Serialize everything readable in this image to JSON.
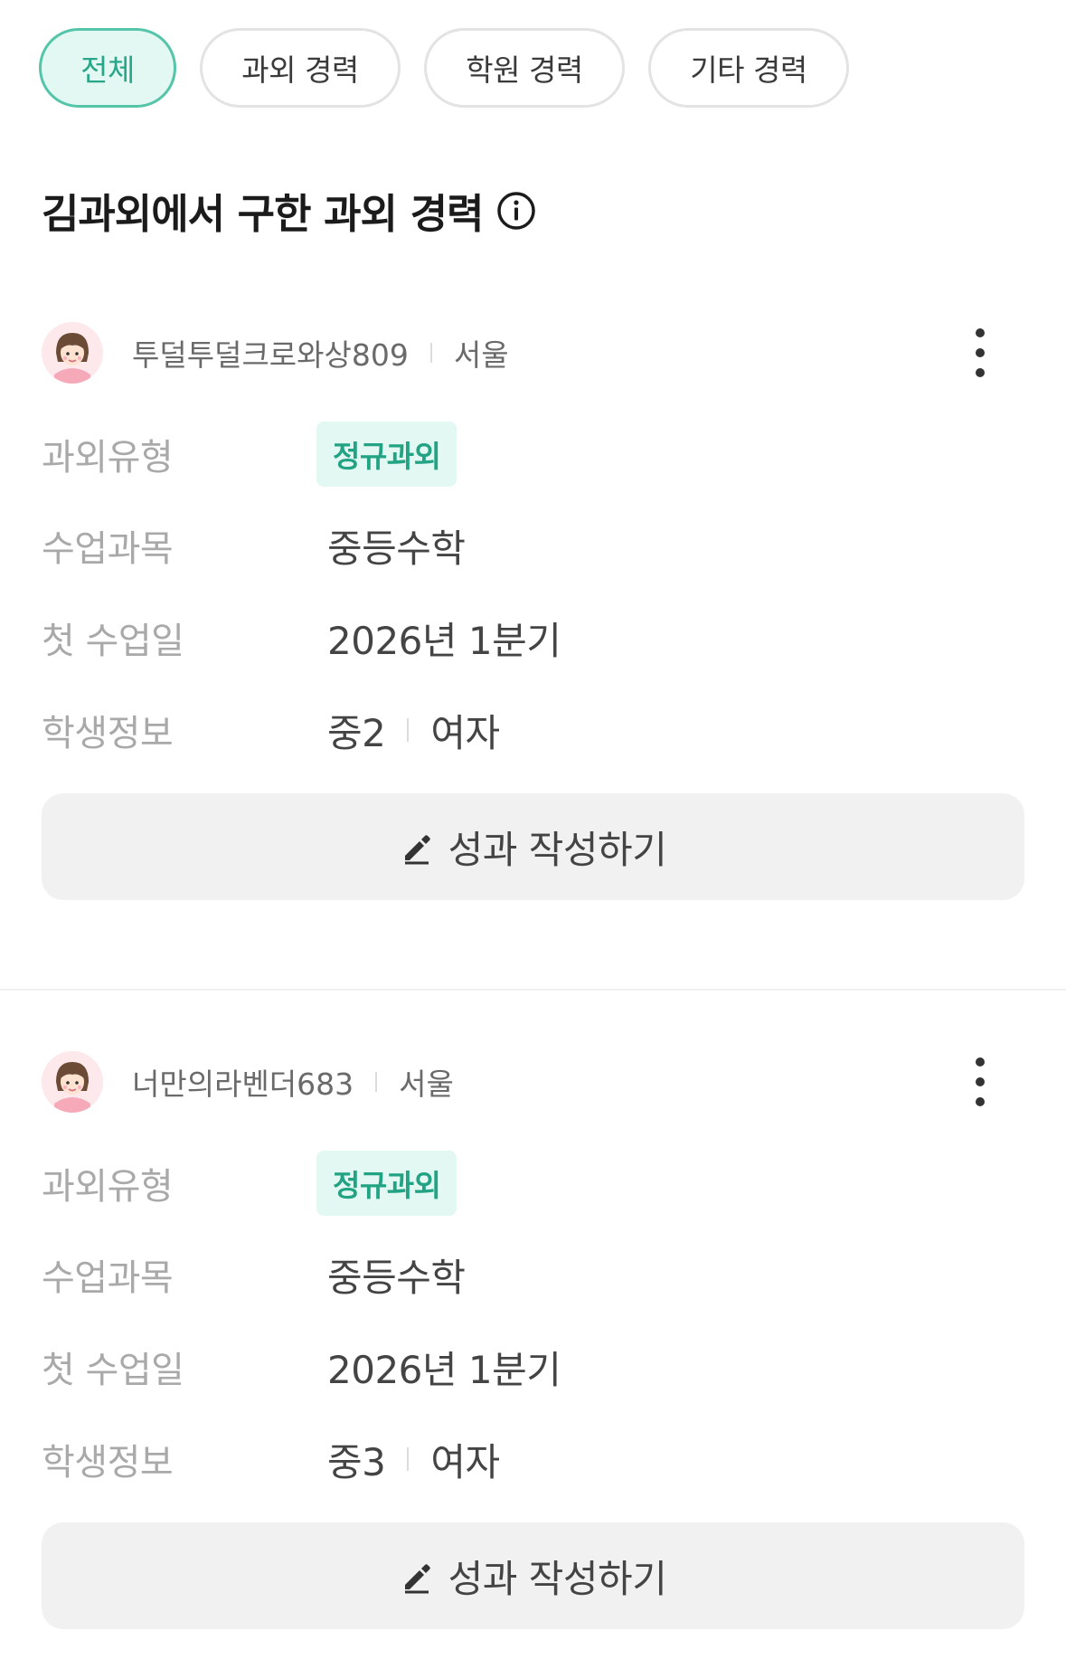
{
  "filters": {
    "chips": [
      {
        "label": "전체",
        "active": true
      },
      {
        "label": "과외 경력",
        "active": false
      },
      {
        "label": "학원 경력",
        "active": false
      },
      {
        "label": "기타 경력",
        "active": false
      }
    ]
  },
  "section": {
    "title": "김과외에서 구한 과외 경력",
    "info_icon": "info-circle-icon"
  },
  "field_labels": {
    "type": "과외유형",
    "subject": "수업과목",
    "first_class": "첫 수업일",
    "student": "학생정보"
  },
  "cards": [
    {
      "nickname": "투덜투덜크로와상809",
      "region": "서울",
      "type": "정규과외",
      "subject": "중등수학",
      "first_class": "2026년 1분기",
      "student_grade": "중2",
      "student_gender": "여자",
      "button_label": "성과 작성하기"
    },
    {
      "nickname": "너만의라벤더683",
      "region": "서울",
      "type": "정규과외",
      "subject": "중등수학",
      "first_class": "2026년 1분기",
      "student_grade": "중3",
      "student_gender": "여자",
      "button_label": "성과 작성하기"
    }
  ],
  "colors": {
    "accent": "#27a787",
    "accent_bg": "#e3f8f2",
    "button_bg": "#f1f1f1",
    "label_gray": "#a9a9a9"
  }
}
